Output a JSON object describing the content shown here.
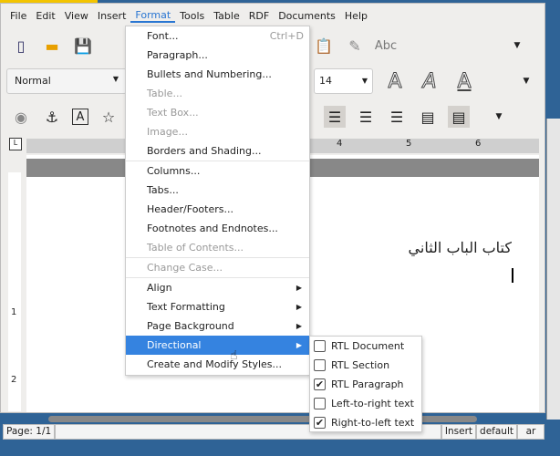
{
  "menubar": [
    "File",
    "Edit",
    "View",
    "Insert",
    "Format",
    "Tools",
    "Table",
    "RDF",
    "Documents",
    "Help"
  ],
  "toolbar": {
    "style": "Normal",
    "font_size": "14"
  },
  "format_menu": [
    {
      "label": "Font...",
      "shortcut": "Ctrl+D"
    },
    {
      "label": "Paragraph..."
    },
    {
      "label": "Bullets and Numbering..."
    },
    {
      "label": "Table...",
      "disabled": true
    },
    {
      "label": "Text Box...",
      "disabled": true
    },
    {
      "label": "Image...",
      "disabled": true
    },
    {
      "label": "Borders and Shading..."
    },
    {
      "label": "Columns..."
    },
    {
      "label": "Tabs..."
    },
    {
      "label": "Header/Footers..."
    },
    {
      "label": "Footnotes and Endnotes..."
    },
    {
      "label": "Table of Contents...",
      "disabled": true
    },
    {
      "label": "Change Case...",
      "disabled": true
    },
    {
      "label": "Align",
      "submenu": true
    },
    {
      "label": "Text Formatting",
      "submenu": true
    },
    {
      "label": "Page Background",
      "submenu": true
    },
    {
      "label": "Directional",
      "submenu": true,
      "highlighted": true
    },
    {
      "label": "Create and Modify Styles..."
    }
  ],
  "directional_submenu": [
    {
      "label": "RTL Document",
      "checked": false
    },
    {
      "label": "RTL Section",
      "checked": false
    },
    {
      "label": "RTL Paragraph",
      "checked": true
    },
    {
      "label": "Left-to-right text",
      "checked": false
    },
    {
      "label": "Right-to-left text",
      "checked": true
    }
  ],
  "ruler": [
    "4",
    "5",
    "6"
  ],
  "vruler": [
    "1",
    "2"
  ],
  "document": {
    "text": "كتاب الباب الثاني"
  },
  "status": {
    "page": "Page: 1/1",
    "mode": "Insert",
    "style": "default",
    "lang": "ar"
  },
  "colors": {
    "highlight": "#3583e0",
    "desktop": "#2f6396"
  }
}
